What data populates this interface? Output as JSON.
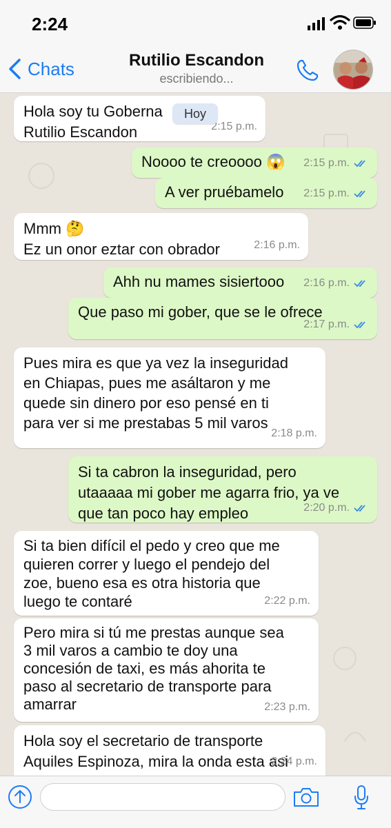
{
  "status_bar": {
    "time": "2:24"
  },
  "header": {
    "back_label": "Chats",
    "contact_name": "Rutilio Escandon",
    "status": "escribiendo..."
  },
  "day_badge": "Hoy",
  "messages": [
    {
      "dir": "in",
      "text": "Hola soy tu Goberna\nRutilio Escandon",
      "time": "2:15 p.m."
    },
    {
      "dir": "out",
      "text": "Noooo te creoooo 😱",
      "time": "2:15 p.m.",
      "read": true
    },
    {
      "dir": "out",
      "text": "A ver pruébamelo",
      "time": "2:15 p.m.",
      "read": true
    },
    {
      "dir": "in",
      "text": "Mmm 🤔\nEz un onor eztar con obrador",
      "time": "2:16 p.m."
    },
    {
      "dir": "out",
      "text": "Ahh nu mames sisiertooo",
      "time": "2:16 p.m.",
      "read": true
    },
    {
      "dir": "out",
      "text": "Que paso mi gober, que se le ofrece",
      "time": "2:17 p.m.",
      "read": true
    },
    {
      "dir": "in",
      "text": "Pues mira es que ya vez la inseguridad\nen Chiapas, pues me asáltaron y me\nquede sin dinero por eso pensé en ti\npara ver si me prestabas 5 mil varos",
      "time": "2:18 p.m."
    },
    {
      "dir": "out",
      "text": "Si ta cabron la inseguridad, pero\nutaaaaa mi gober me agarra frio, ya ve\nque tan poco hay empleo",
      "time": "2:20 p.m.",
      "read": true
    },
    {
      "dir": "in",
      "text": "Si ta bien difícil el pedo y creo que me\nquieren correr y luego el pendejo del\nzoe, bueno esa es otra historia que\nluego te contaré",
      "time": "2:22 p.m."
    },
    {
      "dir": "in",
      "text": "Pero mira si tú me prestas aunque sea\n3 mil varos a cambio te doy una\nconcesión de taxi, es más ahorita te\npaso al secretario de transporte para\namarrar",
      "time": "2:23 p.m."
    },
    {
      "dir": "in",
      "text": "Hola soy el secretario de transporte\nAquiles Espinoza, mira la onda esta asi",
      "time": "2:24 p.m."
    }
  ],
  "icons": {
    "back": "chevron-left-icon",
    "call": "phone-icon",
    "attach": "upload-arrow-icon",
    "camera": "camera-icon",
    "voice": "microphone-icon",
    "read_receipt": "double-check-icon"
  },
  "colors": {
    "ios_blue": "#1a7cf5",
    "outgoing_bubble": "#dcf8c6",
    "incoming_bubble": "#ffffff",
    "chat_background": "#e9e4dc"
  }
}
